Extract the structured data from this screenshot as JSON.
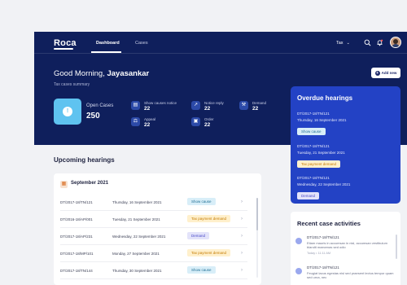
{
  "nav": {
    "logo": "Roca",
    "tabs": [
      "Dashboard",
      "Cases"
    ],
    "tax_select": "Tax"
  },
  "hero": {
    "greeting_prefix": "Good Morning,",
    "user_name": "Jayasankar",
    "subtitle": "Tax cases summary",
    "add_button": "Add new",
    "open_cases_label": "Open Cases",
    "open_cases_value": "250",
    "stats": [
      {
        "label": "Show causes notice",
        "value": "22"
      },
      {
        "label": "Notice reply",
        "value": "22"
      },
      {
        "label": "Demand",
        "value": "22"
      },
      {
        "label": "Appeal",
        "value": "22"
      },
      {
        "label": "Order",
        "value": "22"
      }
    ]
  },
  "overdue": {
    "title": "Overdue hearings",
    "items": [
      {
        "id": "DT/2017-18/TN/121",
        "date": "Thursday, 16 September 2021",
        "badge": "Show cause"
      },
      {
        "id": "DT/2017-18/TN/121",
        "date": "Tuesday, 21 September 2021",
        "badge": "Tax payment demand"
      },
      {
        "id": "DT/2017-18/TN/121",
        "date": "Wednesday, 22 September 2021",
        "badge": "Demand"
      }
    ]
  },
  "upcoming": {
    "title": "Upcoming hearings",
    "month": "September 2021",
    "rows": [
      {
        "id": "DT/2017-18/TN/121",
        "date": "Thursday, 16 September 2021",
        "badge": "Show cause"
      },
      {
        "id": "DT/2016-18/AP/001",
        "date": "Tuesday, 21 September 2021",
        "badge": "Tax payment demand"
      },
      {
        "id": "DT/2017-18/AP/231",
        "date": "Wednesday, 22 September 2021",
        "badge": "Demand"
      },
      {
        "id": "DT/2017-18/MP/101",
        "date": "Monday, 27 September 2021",
        "badge": "Tax payment demand"
      },
      {
        "id": "DT/2017-18/TN/144",
        "date": "Thursday, 30 September 2021",
        "badge": "Show cause"
      }
    ]
  },
  "recent": {
    "title": "Recent case activities",
    "items": [
      {
        "id": "DT/2017-18/TN/121",
        "text": "Etiam mauris in accumsan in nisl, accumsan vestibulum blandit maecenas sed odio",
        "time": "Today  •  11:11 AM"
      },
      {
        "id": "DT/2017-18/TN/121",
        "text": "Feugiat lacus egestas nisl sed praesent lectus tempor quam sed urna, nec"
      }
    ]
  },
  "colors": {
    "hero_bg": "#0f1f5c",
    "accent": "#2342c5",
    "open_cases": "#5fc3f0"
  }
}
